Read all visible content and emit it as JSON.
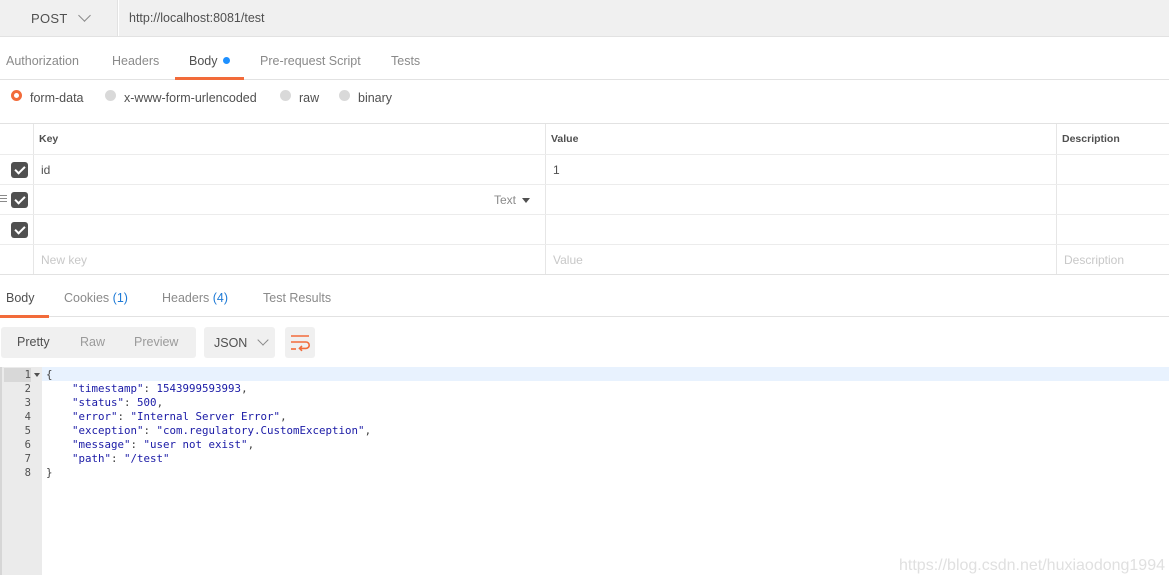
{
  "request": {
    "method": "POST",
    "url": "http://localhost:8081/test"
  },
  "request_tabs": [
    {
      "label": "Authorization",
      "active": false
    },
    {
      "label": "Headers",
      "active": false
    },
    {
      "label": "Body",
      "active": true,
      "indicator": true
    },
    {
      "label": "Pre-request Script",
      "active": false
    },
    {
      "label": "Tests",
      "active": false
    }
  ],
  "body_types": [
    {
      "label": "form-data",
      "selected": true
    },
    {
      "label": "x-www-form-urlencoded",
      "selected": false
    },
    {
      "label": "raw",
      "selected": false
    },
    {
      "label": "binary",
      "selected": false
    }
  ],
  "params_table": {
    "headers": {
      "key": "Key",
      "value": "Value",
      "description": "Description"
    },
    "rows": [
      {
        "checked": true,
        "key": "id",
        "value": "1",
        "description": ""
      },
      {
        "checked": true,
        "key": "",
        "value": "",
        "description": "",
        "type_select": "Text"
      },
      {
        "checked": true,
        "key": "",
        "value": "",
        "description": ""
      }
    ],
    "placeholders": {
      "key": "New key",
      "value": "Value",
      "description": "Description"
    }
  },
  "response_tabs": [
    {
      "label": "Body",
      "count": "",
      "active": true
    },
    {
      "label": "Cookies",
      "count": "(1)",
      "active": false
    },
    {
      "label": "Headers",
      "count": "(4)",
      "active": false
    },
    {
      "label": "Test Results",
      "count": "",
      "active": false
    }
  ],
  "view_modes": [
    "Pretty",
    "Raw",
    "Preview"
  ],
  "active_view_mode": "Pretty",
  "format": "JSON",
  "response_lines": [
    {
      "num": "1",
      "text": "{"
    },
    {
      "num": "2",
      "key": "\"timestamp\"",
      "val": "1543999593993",
      "tail": ","
    },
    {
      "num": "3",
      "key": "\"status\"",
      "val": "500",
      "tail": ","
    },
    {
      "num": "4",
      "key": "\"error\"",
      "val": "\"Internal Server Error\"",
      "tail": ","
    },
    {
      "num": "5",
      "key": "\"exception\"",
      "val": "\"com.regulatory.CustomException\"",
      "tail": ","
    },
    {
      "num": "6",
      "key": "\"message\"",
      "val": "\"user not exist\"",
      "tail": ","
    },
    {
      "num": "7",
      "key": "\"path\"",
      "val": "\"/test\"",
      "tail": ""
    },
    {
      "num": "8",
      "text": "}"
    }
  ],
  "watermark": "https://blog.csdn.net/huxiaodong1994",
  "colors": {
    "accent": "#f26b3a",
    "link": "#1e7ad6",
    "dot": "#1e90ff"
  }
}
